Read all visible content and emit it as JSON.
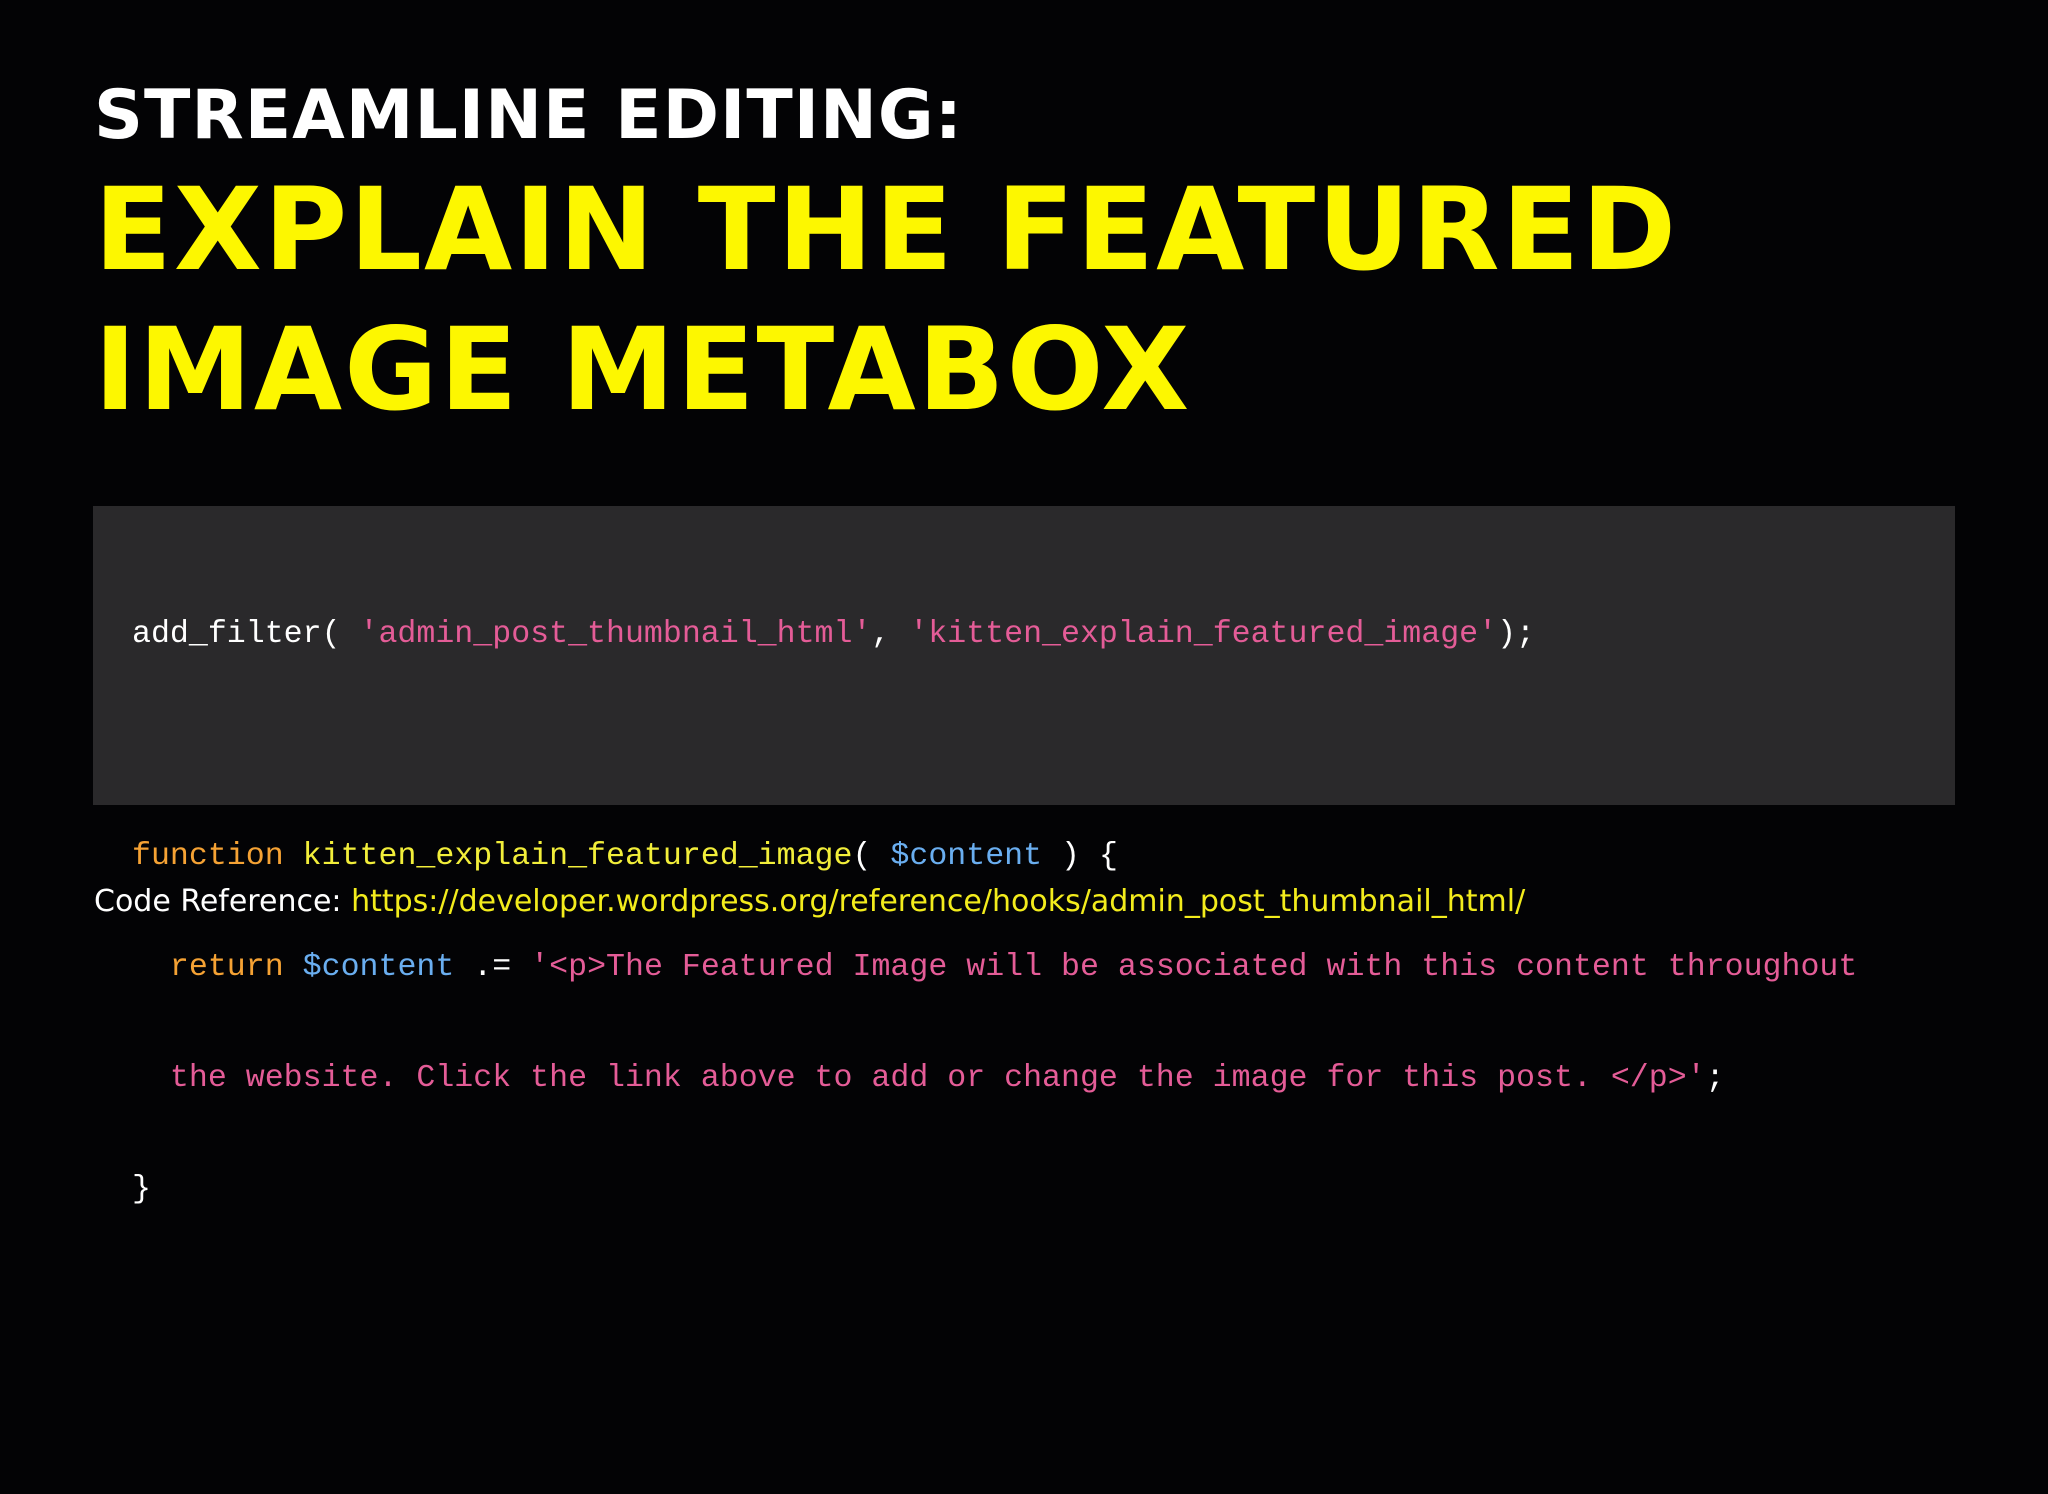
{
  "slide": {
    "kicker": "STREAMLINE EDITING:",
    "title_lines": [
      "EXPLAIN THE FEATURED",
      "IMAGE METABOX"
    ]
  },
  "code": {
    "line1": {
      "t1": "add_filter( ",
      "t2": "'admin_post_thumbnail_html'",
      "t3": ", ",
      "t4": "'kitten_explain_featured_image'",
      "t5": ");"
    },
    "line3": {
      "t1": "function",
      "t2": " ",
      "t3": "kitten_explain_featured_image",
      "t4": "( ",
      "t5": "$content",
      "t6": " ) {"
    },
    "line4": {
      "t1": "  ",
      "t2": "return",
      "t3": " ",
      "t4": "$content",
      "t5": " .= ",
      "t6": "'<p>The Featured Image will be associated with this content throughout"
    },
    "line5": {
      "t1": "  ",
      "t2": "the website. Click the link above to add or change the image for this post. </p>'",
      "t3": ";"
    },
    "line6": {
      "t1": "}"
    }
  },
  "reference": {
    "label": "Code Reference: ",
    "url": "https://developer.wordpress.org/reference/hooks/admin_post_thumbnail_html/"
  },
  "colors": {
    "background": "#030305",
    "title_yellow": "#fdf700",
    "code_panel": "#2a292b",
    "string": "#e45c97",
    "keyword": "#f5a234",
    "function_name": "#f2ee3a",
    "variable": "#6aaef0",
    "link": "#f3ec1c"
  }
}
